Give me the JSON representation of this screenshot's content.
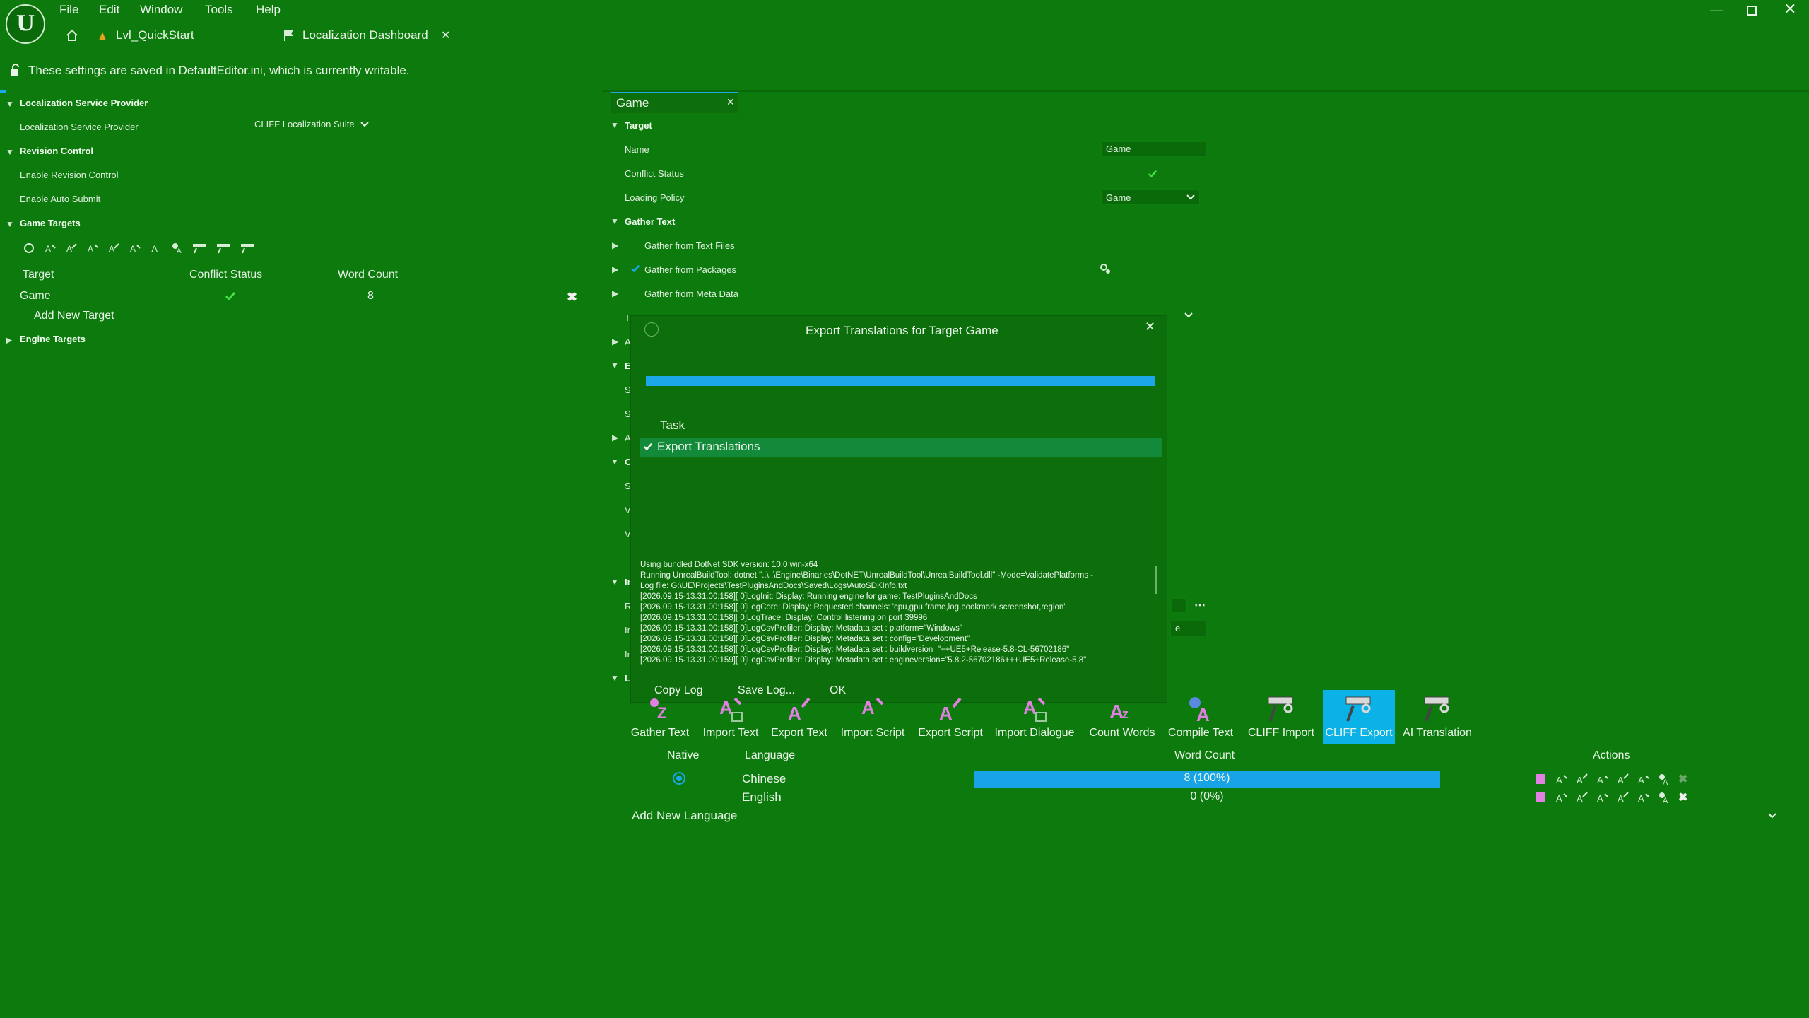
{
  "menubar": {
    "items": [
      "File",
      "Edit",
      "Window",
      "Tools",
      "Help"
    ]
  },
  "tabs": {
    "level_tab": "Lvl_QuickStart",
    "dashboard_tab": "Localization Dashboard"
  },
  "info_text": "These settings are saved in DefaultEditor.ini, which is currently writable.",
  "left": {
    "lsp_section": "Localization Service Provider",
    "lsp_label": "Localization Service Provider",
    "lsp_value": "CLIFF Localization Suite",
    "rev_section": "Revision Control",
    "enable_rev": "Enable Revision Control",
    "enable_auto": "Enable Auto Submit",
    "game_targets": "Game Targets",
    "col_target": "Target",
    "col_conflict": "Conflict Status",
    "col_wordcount": "Word Count",
    "row_target": "Game",
    "row_wordcount": "8",
    "add_target": "Add New Target",
    "engine_targets": "Engine Targets"
  },
  "right": {
    "tab_label": "Game",
    "target_section": "Target",
    "name_label": "Name",
    "name_value": "Game",
    "conflict_label": "Conflict Status",
    "loading_label": "Loading Policy",
    "loading_value": "Game",
    "gather_section": "Gather Text",
    "gather_text_files": "Gather from Text Files",
    "gather_packages": "Gather from Packages",
    "gather_meta": "Gather from Meta Data",
    "trunc_ta": "Ta",
    "trunc_ad": "Ad",
    "trunc_ex": "Ex",
    "trunc_sh1": "Sh",
    "trunc_sh2": "Sh",
    "trunc_ad2": "Ad",
    "trunc_co": "Co",
    "trunc_sk": "Sk",
    "trunc_va1": "Va",
    "trunc_va2": "Va",
    "trunc_im": "Im",
    "trunc_ra": "Ra",
    "trunc_im2": "Im",
    "trunc_im3": "Im",
    "trunc_la": "La",
    "field_e": "e"
  },
  "dialog": {
    "title": "Export Translations for Target Game",
    "progress": 1.0,
    "task_header": "Task",
    "task_row": "Export Translations",
    "log_lines": [
      "Using bundled DotNet SDK version: 10.0 win-x64",
      "Running UnrealBuildTool: dotnet \"..\\..\\Engine\\Binaries\\DotNET\\UnrealBuildTool\\UnrealBuildTool.dll\" -Mode=ValidatePlatforms -",
      "Log file: G:\\UE\\Projects\\TestPluginsAndDocs\\Saved\\Logs\\AutoSDKInfo.txt",
      "[2026.09.15-13.31.00:158][  0]LogInit: Display: Running engine for game: TestPluginsAndDocs",
      "[2026.09.15-13.31.00:158][  0]LogCore: Display: Requested channels: 'cpu,gpu,frame,log,bookmark,screenshot,region'",
      "[2026.09.15-13.31.00:158][  0]LogTrace: Display: Control listening on port 39996",
      "[2026.09.15-13.31.00:158][  0]LogCsvProfiler: Display: Metadata set : platform=\"Windows\"",
      "[2026.09.15-13.31.00:158][  0]LogCsvProfiler: Display: Metadata set : config=\"Development\"",
      "[2026.09.15-13.31.00:158][  0]LogCsvProfiler: Display: Metadata set : buildversion=\"++UE5+Release-5.8-CL-56702186\"",
      "[2026.09.15-13.31.00:159][  0]LogCsvProfiler: Display: Metadata set : engineversion=\"5.8.2-56702186+++UE5+Release-5.8\""
    ],
    "copy_log": "Copy Log",
    "save_log": "Save Log...",
    "ok": "OK"
  },
  "toolbar": {
    "gather": "Gather Text",
    "import_text": "Import Text",
    "export_text": "Export Text",
    "import_script": "Import Script",
    "export_script": "Export Script",
    "import_dialogue": "Import Dialogue",
    "count_words": "Count Words",
    "compile_text": "Compile Text",
    "cliff_import": "CLIFF Import",
    "cliff_export": "CLIFF Export",
    "ai_translation": "AI Translation"
  },
  "languages": {
    "col_native": "Native",
    "col_language": "Language",
    "col_wordcount": "Word Count",
    "col_actions": "Actions",
    "rows": [
      {
        "language": "Chinese",
        "wordcount": "8 (100%)",
        "fraction": 1.0,
        "native": true
      },
      {
        "language": "English",
        "wordcount": "0 (0%)",
        "fraction": 0.0,
        "native": false
      }
    ],
    "add_language": "Add New Language"
  },
  "colors": {
    "background": "#0c7a0c",
    "accent": "#1ba7e8",
    "check": "#44e044",
    "action_pink": "#e080e0"
  }
}
